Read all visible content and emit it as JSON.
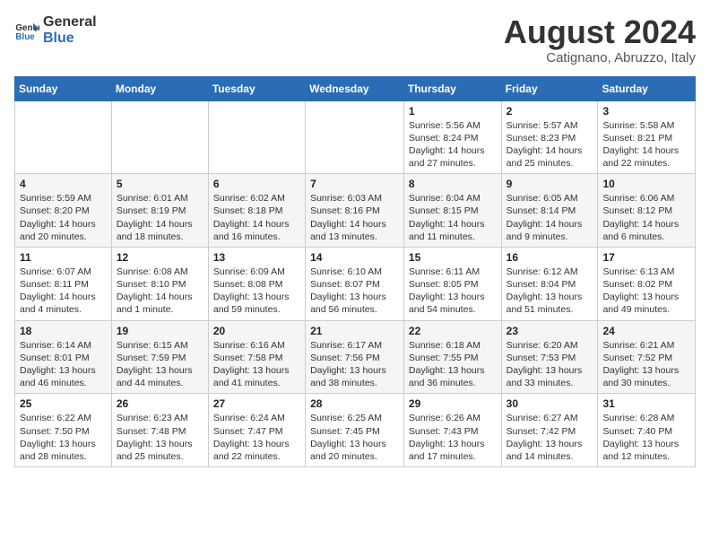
{
  "logo": {
    "line1": "General",
    "line2": "Blue"
  },
  "title": "August 2024",
  "subtitle": "Catignano, Abruzzo, Italy",
  "days_of_week": [
    "Sunday",
    "Monday",
    "Tuesday",
    "Wednesday",
    "Thursday",
    "Friday",
    "Saturday"
  ],
  "weeks": [
    [
      {
        "day": "",
        "info": ""
      },
      {
        "day": "",
        "info": ""
      },
      {
        "day": "",
        "info": ""
      },
      {
        "day": "",
        "info": ""
      },
      {
        "day": "1",
        "info": "Sunrise: 5:56 AM\nSunset: 8:24 PM\nDaylight: 14 hours and 27 minutes."
      },
      {
        "day": "2",
        "info": "Sunrise: 5:57 AM\nSunset: 8:23 PM\nDaylight: 14 hours and 25 minutes."
      },
      {
        "day": "3",
        "info": "Sunrise: 5:58 AM\nSunset: 8:21 PM\nDaylight: 14 hours and 22 minutes."
      }
    ],
    [
      {
        "day": "4",
        "info": "Sunrise: 5:59 AM\nSunset: 8:20 PM\nDaylight: 14 hours and 20 minutes."
      },
      {
        "day": "5",
        "info": "Sunrise: 6:01 AM\nSunset: 8:19 PM\nDaylight: 14 hours and 18 minutes."
      },
      {
        "day": "6",
        "info": "Sunrise: 6:02 AM\nSunset: 8:18 PM\nDaylight: 14 hours and 16 minutes."
      },
      {
        "day": "7",
        "info": "Sunrise: 6:03 AM\nSunset: 8:16 PM\nDaylight: 14 hours and 13 minutes."
      },
      {
        "day": "8",
        "info": "Sunrise: 6:04 AM\nSunset: 8:15 PM\nDaylight: 14 hours and 11 minutes."
      },
      {
        "day": "9",
        "info": "Sunrise: 6:05 AM\nSunset: 8:14 PM\nDaylight: 14 hours and 9 minutes."
      },
      {
        "day": "10",
        "info": "Sunrise: 6:06 AM\nSunset: 8:12 PM\nDaylight: 14 hours and 6 minutes."
      }
    ],
    [
      {
        "day": "11",
        "info": "Sunrise: 6:07 AM\nSunset: 8:11 PM\nDaylight: 14 hours and 4 minutes."
      },
      {
        "day": "12",
        "info": "Sunrise: 6:08 AM\nSunset: 8:10 PM\nDaylight: 14 hours and 1 minute."
      },
      {
        "day": "13",
        "info": "Sunrise: 6:09 AM\nSunset: 8:08 PM\nDaylight: 13 hours and 59 minutes."
      },
      {
        "day": "14",
        "info": "Sunrise: 6:10 AM\nSunset: 8:07 PM\nDaylight: 13 hours and 56 minutes."
      },
      {
        "day": "15",
        "info": "Sunrise: 6:11 AM\nSunset: 8:05 PM\nDaylight: 13 hours and 54 minutes."
      },
      {
        "day": "16",
        "info": "Sunrise: 6:12 AM\nSunset: 8:04 PM\nDaylight: 13 hours and 51 minutes."
      },
      {
        "day": "17",
        "info": "Sunrise: 6:13 AM\nSunset: 8:02 PM\nDaylight: 13 hours and 49 minutes."
      }
    ],
    [
      {
        "day": "18",
        "info": "Sunrise: 6:14 AM\nSunset: 8:01 PM\nDaylight: 13 hours and 46 minutes."
      },
      {
        "day": "19",
        "info": "Sunrise: 6:15 AM\nSunset: 7:59 PM\nDaylight: 13 hours and 44 minutes."
      },
      {
        "day": "20",
        "info": "Sunrise: 6:16 AM\nSunset: 7:58 PM\nDaylight: 13 hours and 41 minutes."
      },
      {
        "day": "21",
        "info": "Sunrise: 6:17 AM\nSunset: 7:56 PM\nDaylight: 13 hours and 38 minutes."
      },
      {
        "day": "22",
        "info": "Sunrise: 6:18 AM\nSunset: 7:55 PM\nDaylight: 13 hours and 36 minutes."
      },
      {
        "day": "23",
        "info": "Sunrise: 6:20 AM\nSunset: 7:53 PM\nDaylight: 13 hours and 33 minutes."
      },
      {
        "day": "24",
        "info": "Sunrise: 6:21 AM\nSunset: 7:52 PM\nDaylight: 13 hours and 30 minutes."
      }
    ],
    [
      {
        "day": "25",
        "info": "Sunrise: 6:22 AM\nSunset: 7:50 PM\nDaylight: 13 hours and 28 minutes."
      },
      {
        "day": "26",
        "info": "Sunrise: 6:23 AM\nSunset: 7:48 PM\nDaylight: 13 hours and 25 minutes."
      },
      {
        "day": "27",
        "info": "Sunrise: 6:24 AM\nSunset: 7:47 PM\nDaylight: 13 hours and 22 minutes."
      },
      {
        "day": "28",
        "info": "Sunrise: 6:25 AM\nSunset: 7:45 PM\nDaylight: 13 hours and 20 minutes."
      },
      {
        "day": "29",
        "info": "Sunrise: 6:26 AM\nSunset: 7:43 PM\nDaylight: 13 hours and 17 minutes."
      },
      {
        "day": "30",
        "info": "Sunrise: 6:27 AM\nSunset: 7:42 PM\nDaylight: 13 hours and 14 minutes."
      },
      {
        "day": "31",
        "info": "Sunrise: 6:28 AM\nSunset: 7:40 PM\nDaylight: 13 hours and 12 minutes."
      }
    ]
  ]
}
